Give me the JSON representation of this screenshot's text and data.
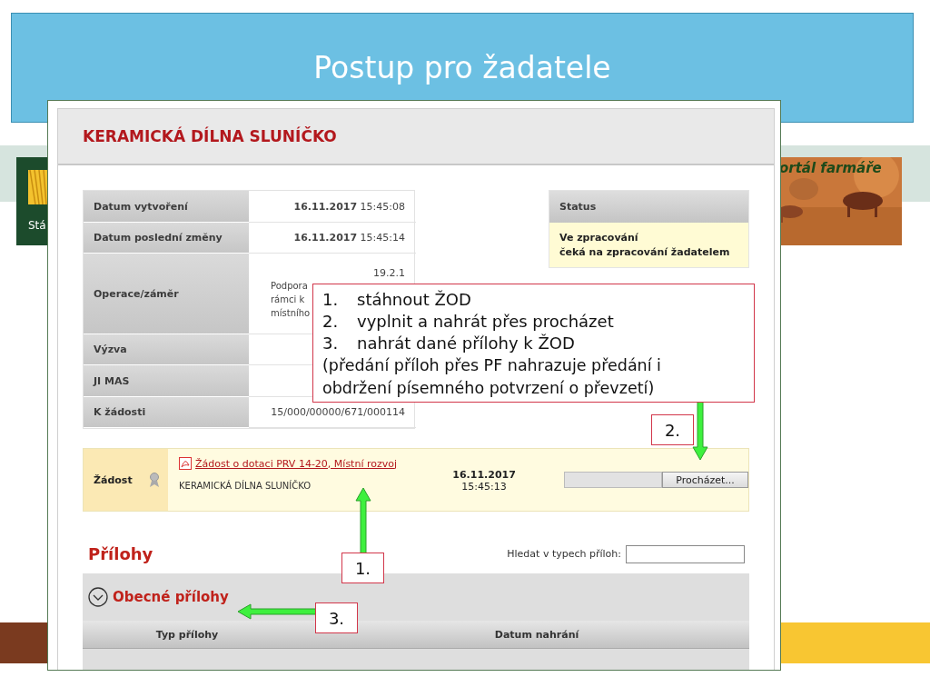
{
  "slide_title": "Postup pro žadatele",
  "background_site": {
    "logo_text": "Stá",
    "banner_text": "ortál farmáře"
  },
  "screenshot": {
    "title": "KERAMICKÁ DÍLNA SLUNÍČKO",
    "details": [
      {
        "label": "Datum vytvoření",
        "value": "**16.11.2017** 15:45:08"
      },
      {
        "label": "Datum poslední změny",
        "value": "**16.11.2017** 15:45:14"
      },
      {
        "label": "Operace/záměr",
        "value": "19.2.1",
        "fragments": [
          "Podpora",
          "rámci k",
          "místního"
        ]
      },
      {
        "label": "Výzva"
      },
      {
        "label": "JI MAS"
      },
      {
        "label": "K žádosti",
        "value": "15/000/00000/671/000114"
      }
    ],
    "status": {
      "heading": "Status",
      "lines": [
        "Ve zpracování",
        "čeká na zpracování žadatelem"
      ]
    },
    "application": {
      "label": "Žádost",
      "link": "Žádost o dotaci PRV 14-20, Místní rozvoj",
      "applicant": "KERAMICKÁ DÍLNA SLUNÍČKO",
      "date": "16.11.2017",
      "time": "15:45:13",
      "browse_button": "Procházet..."
    },
    "attachments": {
      "heading": "Přílohy",
      "search_label": "Hledat v typech příloh:",
      "section": {
        "title": "Obecné přílohy",
        "expanded": true
      },
      "columns": [
        "Typ přílohy",
        "Datum nahrání"
      ]
    }
  },
  "callouts": [
    {
      "kind": "list",
      "items": [
        {
          "number": "1.",
          "text": "stáhnout ŽOD"
        },
        {
          "number": "2.",
          "text": "vyplnit a nahrát přes procházet"
        },
        {
          "number": "3.",
          "text": "nahrát dané přílohy k ŽOD"
        }
      ],
      "note": "(předání příloh přes PF nahrazuje předání i obdržení písemného potvrzení o převzetí)"
    },
    {
      "kind": "down",
      "text": "2."
    },
    {
      "kind": "up",
      "text": "1."
    },
    {
      "kind": "left",
      "text": "3."
    }
  ]
}
